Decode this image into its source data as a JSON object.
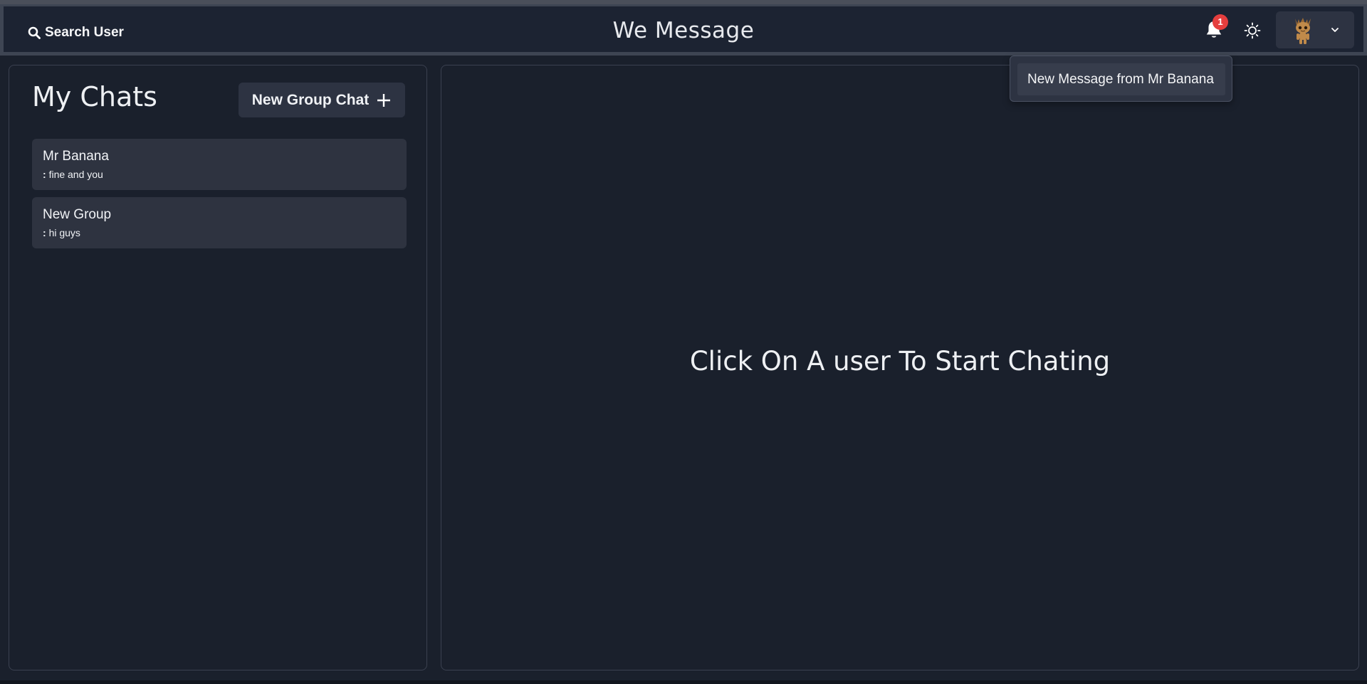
{
  "header": {
    "search_label": "Search User",
    "app_title": "We Message",
    "notification_count": "1"
  },
  "notifications": {
    "items": [
      {
        "label": "New Message from Mr Banana"
      }
    ]
  },
  "sidebar": {
    "title": "My Chats",
    "new_group_label": "New Group Chat",
    "chats": [
      {
        "name": "Mr Banana",
        "preview_prefix": ":",
        "preview": "fine and you"
      },
      {
        "name": "New Group",
        "preview_prefix": ":",
        "preview": "hi guys"
      }
    ]
  },
  "main": {
    "empty_message": "Click On A user To Start Chating"
  },
  "colors": {
    "background": "#1a202c",
    "panel_item": "#2e3340",
    "button": "#2d3342",
    "badge": "#e53e3e"
  },
  "icons": {
    "search": "search-icon",
    "bell": "bell-icon",
    "theme": "sun-icon",
    "plus": "plus-icon",
    "chevron": "chevron-down-icon",
    "avatar": "avatar-groot"
  }
}
